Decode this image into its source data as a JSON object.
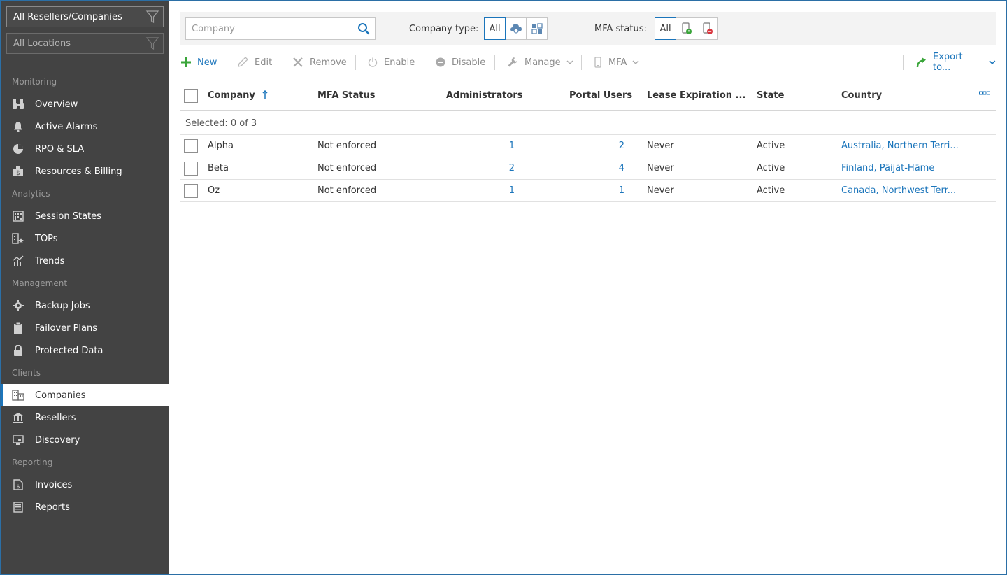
{
  "filters": {
    "resellers": "All Resellers/Companies",
    "locations": "All Locations"
  },
  "sidebar": {
    "sections": [
      {
        "title": "Monitoring",
        "items": [
          {
            "label": "Overview",
            "icon": "binoculars-icon"
          },
          {
            "label": "Active Alarms",
            "icon": "bell-icon"
          },
          {
            "label": "RPO & SLA",
            "icon": "pie-chart-icon"
          },
          {
            "label": "Resources & Billing",
            "icon": "money-bag-icon"
          }
        ]
      },
      {
        "title": "Analytics",
        "items": [
          {
            "label": "Session States",
            "icon": "grid-calendar-icon"
          },
          {
            "label": "TOPs",
            "icon": "building-star-icon"
          },
          {
            "label": "Trends",
            "icon": "trend-chart-icon"
          }
        ]
      },
      {
        "title": "Management",
        "items": [
          {
            "label": "Backup Jobs",
            "icon": "gear-icon"
          },
          {
            "label": "Failover Plans",
            "icon": "clipboard-icon"
          },
          {
            "label": "Protected Data",
            "icon": "lock-icon"
          }
        ]
      },
      {
        "title": "Clients",
        "items": [
          {
            "label": "Companies",
            "icon": "buildings-icon",
            "active": true
          },
          {
            "label": "Resellers",
            "icon": "bank-icon"
          },
          {
            "label": "Discovery",
            "icon": "monitor-icon"
          }
        ]
      },
      {
        "title": "Reporting",
        "items": [
          {
            "label": "Invoices",
            "icon": "invoice-icon"
          },
          {
            "label": "Reports",
            "icon": "report-icon"
          }
        ]
      }
    ]
  },
  "filterbar": {
    "search_placeholder": "Company",
    "company_type_label": "Company type:",
    "company_type_all": "All",
    "mfa_status_label": "MFA status:",
    "mfa_all": "All"
  },
  "toolbar": {
    "new": "New",
    "edit": "Edit",
    "remove": "Remove",
    "enable": "Enable",
    "disable": "Disable",
    "manage": "Manage",
    "mfa": "MFA",
    "export": "Export to..."
  },
  "table": {
    "columns": {
      "company": "Company",
      "mfa_status": "MFA Status",
      "administrators": "Administrators",
      "portal_users": "Portal Users",
      "lease_expiration": "Lease Expiration ...",
      "state": "State",
      "country": "Country"
    },
    "selected_text": "Selected: 0 of 3",
    "rows": [
      {
        "company": "Alpha",
        "mfa": "Not enforced",
        "admins": "1",
        "portal": "2",
        "lease": "Never",
        "state": "Active",
        "country": "Australia, Northern Terri..."
      },
      {
        "company": "Beta",
        "mfa": "Not enforced",
        "admins": "2",
        "portal": "4",
        "lease": "Never",
        "state": "Active",
        "country": "Finland, Päijät-Häme"
      },
      {
        "company": "Oz",
        "mfa": "Not enforced",
        "admins": "1",
        "portal": "1",
        "lease": "Never",
        "state": "Active",
        "country": "Canada, Northwest Terr..."
      }
    ]
  },
  "colors": {
    "sidebar_bg": "#434343",
    "accent": "#1b75bb",
    "new_green": "#3aa53a"
  }
}
